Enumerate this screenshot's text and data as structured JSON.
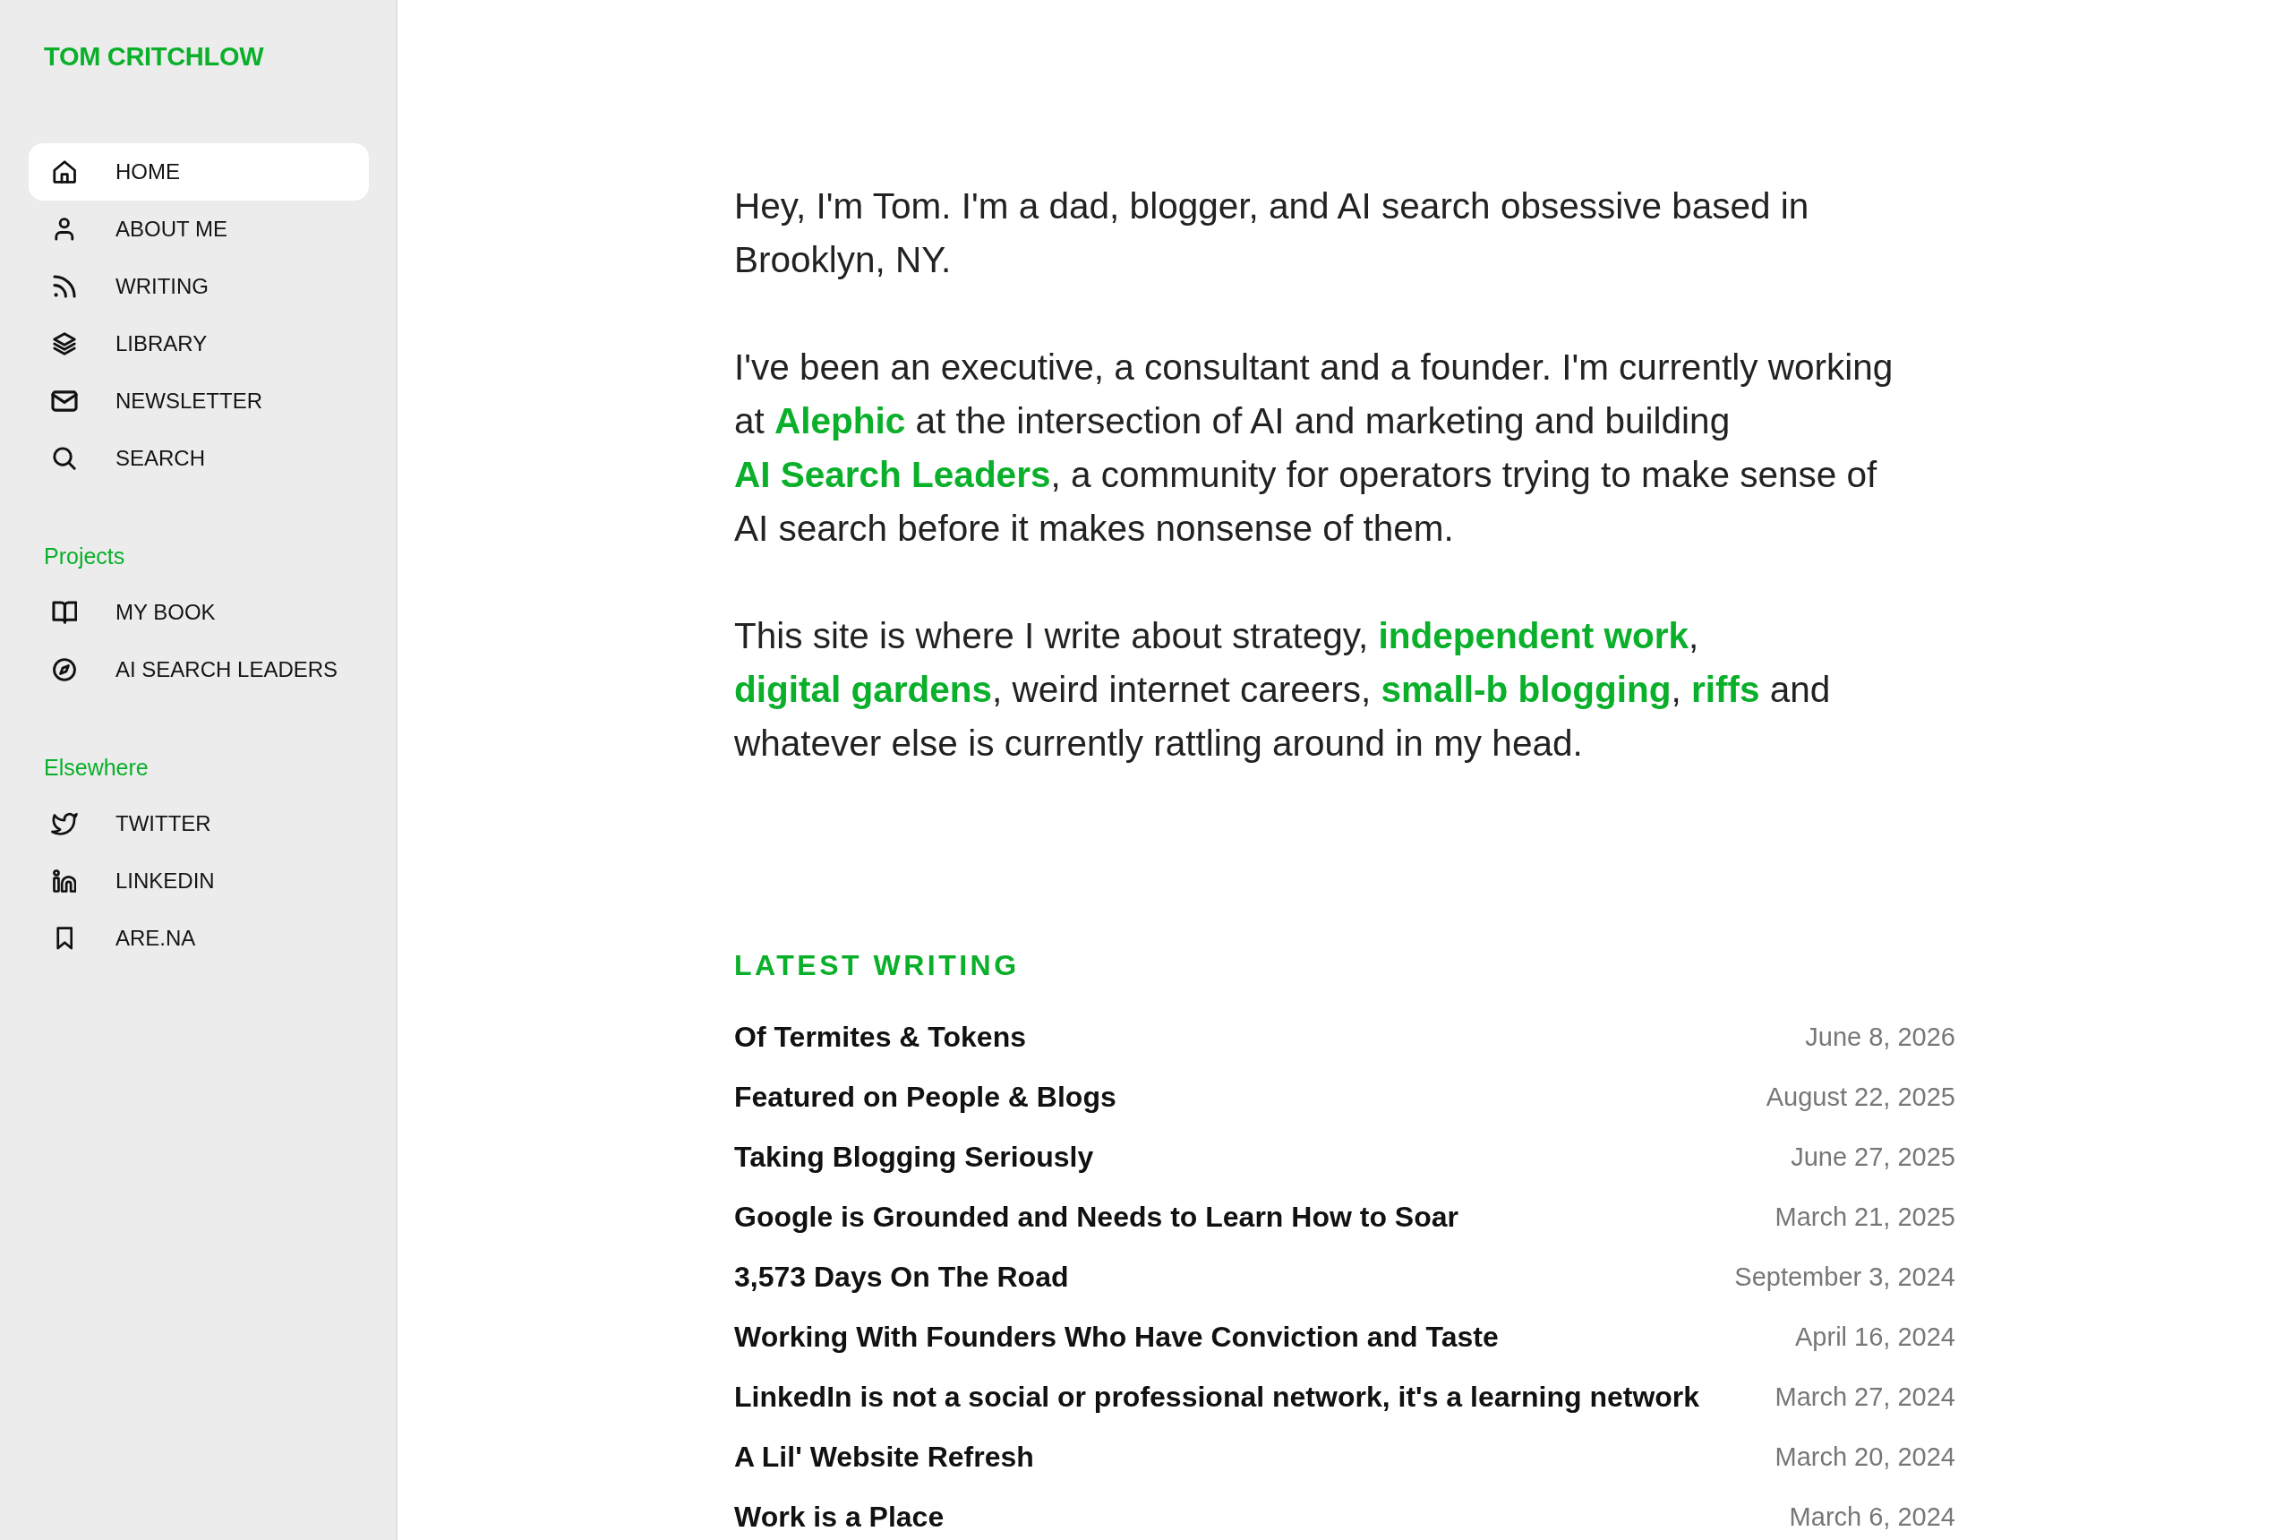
{
  "sidebar": {
    "logo": "TOM CRITCHLOW",
    "nav": [
      {
        "label": "HOME",
        "selected": true
      },
      {
        "label": "ABOUT ME",
        "selected": false
      },
      {
        "label": "WRITING",
        "selected": false
      },
      {
        "label": "LIBRARY",
        "selected": false
      },
      {
        "label": "NEWSLETTER",
        "selected": false
      },
      {
        "label": "SEARCH",
        "selected": false
      }
    ],
    "sections": [
      {
        "title": "Projects",
        "items": [
          {
            "label": "MY BOOK",
            "selected": false
          },
          {
            "label": "AI SEARCH LEADERS",
            "selected": false
          }
        ]
      },
      {
        "title": "Elsewhere",
        "items": [
          {
            "label": "TWITTER",
            "selected": false
          },
          {
            "label": "LINKEDIN",
            "selected": false
          },
          {
            "label": "ARE.NA",
            "selected": false
          }
        ]
      }
    ]
  },
  "intro": {
    "paragraphs": [
      "Hey, I'm Tom. I'm a dad, blogger, and AI search obsessive based in Brooklyn, NY.",
      "I've been an executive, a consultant and a founder. I'm currently working at **Alephic** at the intersection of AI and marketing and building **AI Search Leaders**, a community for operators trying to make sense of AI search before it makes nonsense of them.",
      "This site is where I write about strategy, **independent work**, **digital gardens**, weird internet careers, **small-b blogging**, **riffs** and whatever else is currently rattling around in my head."
    ]
  },
  "latest_writing": {
    "heading": "LATEST WRITING",
    "posts": [
      {
        "title": "Of Termites & Tokens",
        "date": "June 8, 2026"
      },
      {
        "title": "Featured on People & Blogs",
        "date": "August 22, 2025"
      },
      {
        "title": "Taking Blogging Seriously",
        "date": "June 27, 2025"
      },
      {
        "title": "Google is Grounded and Needs to Learn How to Soar",
        "date": "March 21, 2025"
      },
      {
        "title": "3,573 Days On The Road",
        "date": "September 3, 2024"
      },
      {
        "title": "Working With Founders Who Have Conviction and Taste",
        "date": "April 16, 2024"
      },
      {
        "title": "LinkedIn is not a social or professional network, it's a learning network",
        "date": "March 27, 2024"
      },
      {
        "title": "A Lil' Website Refresh",
        "date": "March 20, 2024"
      },
      {
        "title": "Work is a Place",
        "date": "March 6, 2024"
      }
    ]
  }
}
